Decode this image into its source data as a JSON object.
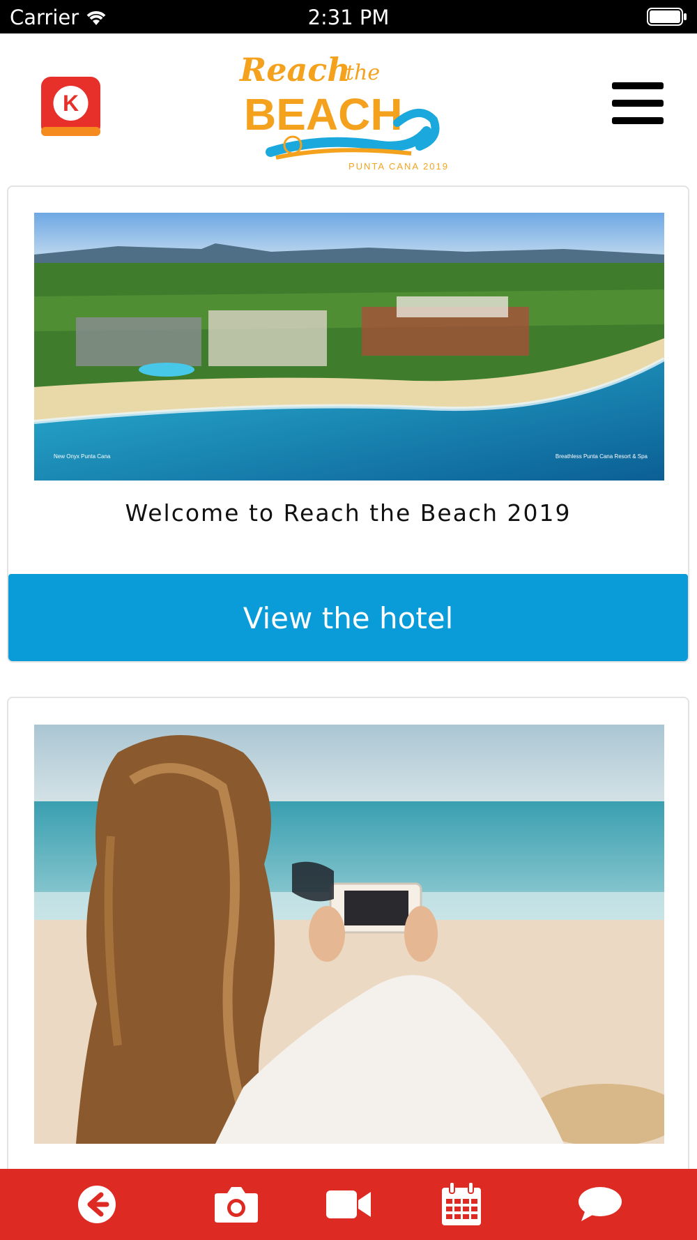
{
  "status_bar": {
    "carrier": "Carrier",
    "time": "2:31 PM"
  },
  "header": {
    "k_logo_letter": "K",
    "event_logo": {
      "line1": "Reach",
      "line1b": "the",
      "line2": "BEACH",
      "subtitle": "PUNTA CANA 2019"
    },
    "menu_icon": "hamburger-menu-icon"
  },
  "feed": {
    "cards": [
      {
        "image": "resort-aerial-photo",
        "image_captions": {
          "left": "New Onyx Punta Cana",
          "right": "Breathless Punta Cana Resort & Spa"
        },
        "title": "Welcome to Reach the Beach 2019",
        "button_label": "View the hotel"
      },
      {
        "image": "woman-taking-phone-photo-on-beach"
      }
    ]
  },
  "tab_bar": {
    "tabs": [
      {
        "icon": "back-arrow-icon"
      },
      {
        "icon": "camera-icon"
      },
      {
        "icon": "video-camera-icon"
      },
      {
        "icon": "calendar-icon"
      },
      {
        "icon": "chat-bubble-icon"
      }
    ]
  },
  "colors": {
    "accent_blue": "#0a9bd9",
    "tab_bar_red": "#dd2a23",
    "logo_orange": "#f4a21e",
    "logo_wave_blue": "#1ba8dd"
  }
}
